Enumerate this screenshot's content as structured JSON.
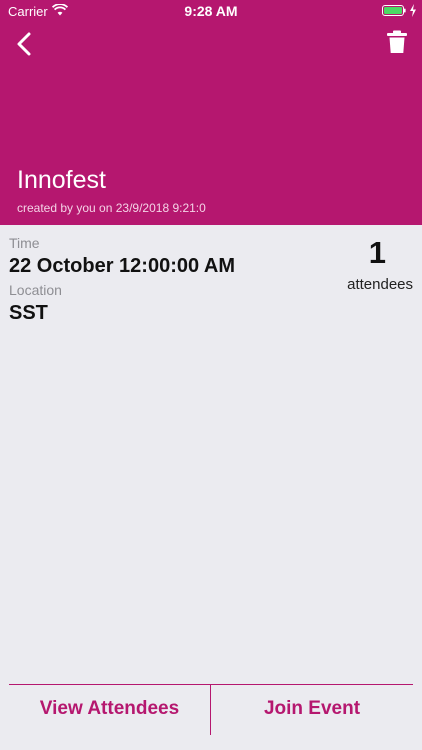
{
  "status_bar": {
    "carrier": "Carrier",
    "time": "9:28 AM"
  },
  "header": {
    "title": "Innofest",
    "subtitle": "created by you on 23/9/2018 9:21:0",
    "back_icon": "chevron-left-icon",
    "delete_icon": "trash-icon"
  },
  "details": {
    "time_label": "Time",
    "time_value": "22 October 12:00:00 AM",
    "location_label": "Location",
    "location_value": "SST",
    "attendee_count": "1",
    "attendee_label": "attendees"
  },
  "footer": {
    "view_attendees_label": "View Attendees",
    "join_event_label": "Join Event"
  },
  "colors": {
    "accent": "#b5176f",
    "background": "#ebebf0",
    "battery": "#4cd964"
  }
}
